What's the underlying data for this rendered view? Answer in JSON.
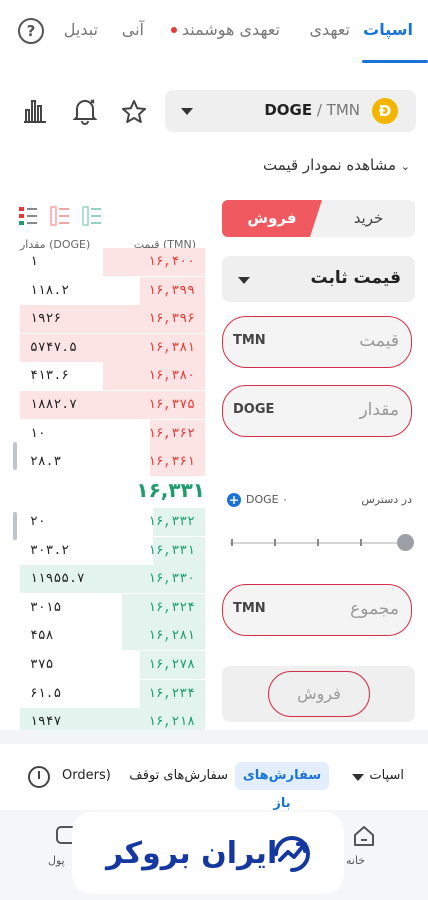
{
  "tabs": [
    {
      "label": "اسپات",
      "active": true
    },
    {
      "label": "تعهدی"
    },
    {
      "label": "تعهدی هوشمند"
    },
    {
      "label": "آنی"
    },
    {
      "label": "تبدیل"
    }
  ],
  "help_icon_label": "?",
  "market": {
    "coin_symbol": "Ð",
    "base": "DOGE",
    "separator": " / ",
    "quote": "TMN"
  },
  "chart_toggle_label": "مشاهده نمودار قیمت",
  "orderbook": {
    "price_header": "قیمت (TMN)",
    "amount_header": "مقدار (DOGE)",
    "asks": [
      {
        "price": "۱۶,۴۰۰",
        "amount": "۱"
      },
      {
        "price": "۱۶,۳۹۹",
        "amount": "۱۱۸.۲"
      },
      {
        "price": "۱۶,۳۹۶",
        "amount": "۱۹۲۶"
      },
      {
        "price": "۱۶,۳۸۱",
        "amount": "۵۷۴۷.۵"
      },
      {
        "price": "۱۶,۳۸۰",
        "amount": "۴۱۳.۶"
      },
      {
        "price": "۱۶,۳۷۵",
        "amount": "۱۸۸۲.۷"
      },
      {
        "price": "۱۶,۳۶۲",
        "amount": "۱۰"
      },
      {
        "price": "۱۶,۳۶۱",
        "amount": "۲۸.۳"
      }
    ],
    "ask_depth": [
      0.55,
      0.35,
      1.0,
      1.0,
      0.55,
      1.0,
      0.3,
      0.3
    ],
    "last_price": "۱۶,۳۳۱",
    "bids": [
      {
        "price": "۱۶,۳۳۲",
        "amount": "۲۰"
      },
      {
        "price": "۱۶,۳۳۱",
        "amount": "۳۰۳.۲"
      },
      {
        "price": "۱۶,۳۳۰",
        "amount": "۱۱۹۵۵.۷"
      },
      {
        "price": "۱۶,۳۲۴",
        "amount": "۳۰۱۵"
      },
      {
        "price": "۱۶,۲۸۱",
        "amount": "۴۵۸"
      },
      {
        "price": "۱۶,۲۷۸",
        "amount": "۳۷۵"
      },
      {
        "price": "۱۶,۲۳۴",
        "amount": "۶۱.۵"
      },
      {
        "price": "۱۶,۲۱۸",
        "amount": "۱۹۴۷"
      }
    ],
    "bid_depth": [
      0.28,
      0.28,
      1.0,
      0.45,
      0.45,
      0.35,
      0.35,
      1.0
    ]
  },
  "order_form": {
    "buy_label": "خرید",
    "sell_label": "فروش",
    "order_type": "قیمت ثابت",
    "price_placeholder": "قیمت",
    "price_unit": "TMN",
    "amount_placeholder": "مقدار",
    "amount_unit": "DOGE",
    "available_label": "در دسترس",
    "available_value": "DOGE ۰",
    "plus_label": "+",
    "total_placeholder": "مجموع",
    "total_unit": "TMN",
    "submit_label": "فروش"
  },
  "orders_bar": {
    "market_label": "اسپات",
    "open_orders": "سفارش‌های باز",
    "stop_orders": "سفارش‌های توقف",
    "overflow": "Orders)"
  },
  "bottom_nav": {
    "home": "خانه",
    "wallet": "پول"
  },
  "logo_text": "ایران بروکر",
  "colors": {
    "accent": "#1a74d8",
    "sell": "#e53935",
    "buy": "#1d9c6c",
    "field_border": "#d32f48",
    "logo": "#1538a0"
  }
}
